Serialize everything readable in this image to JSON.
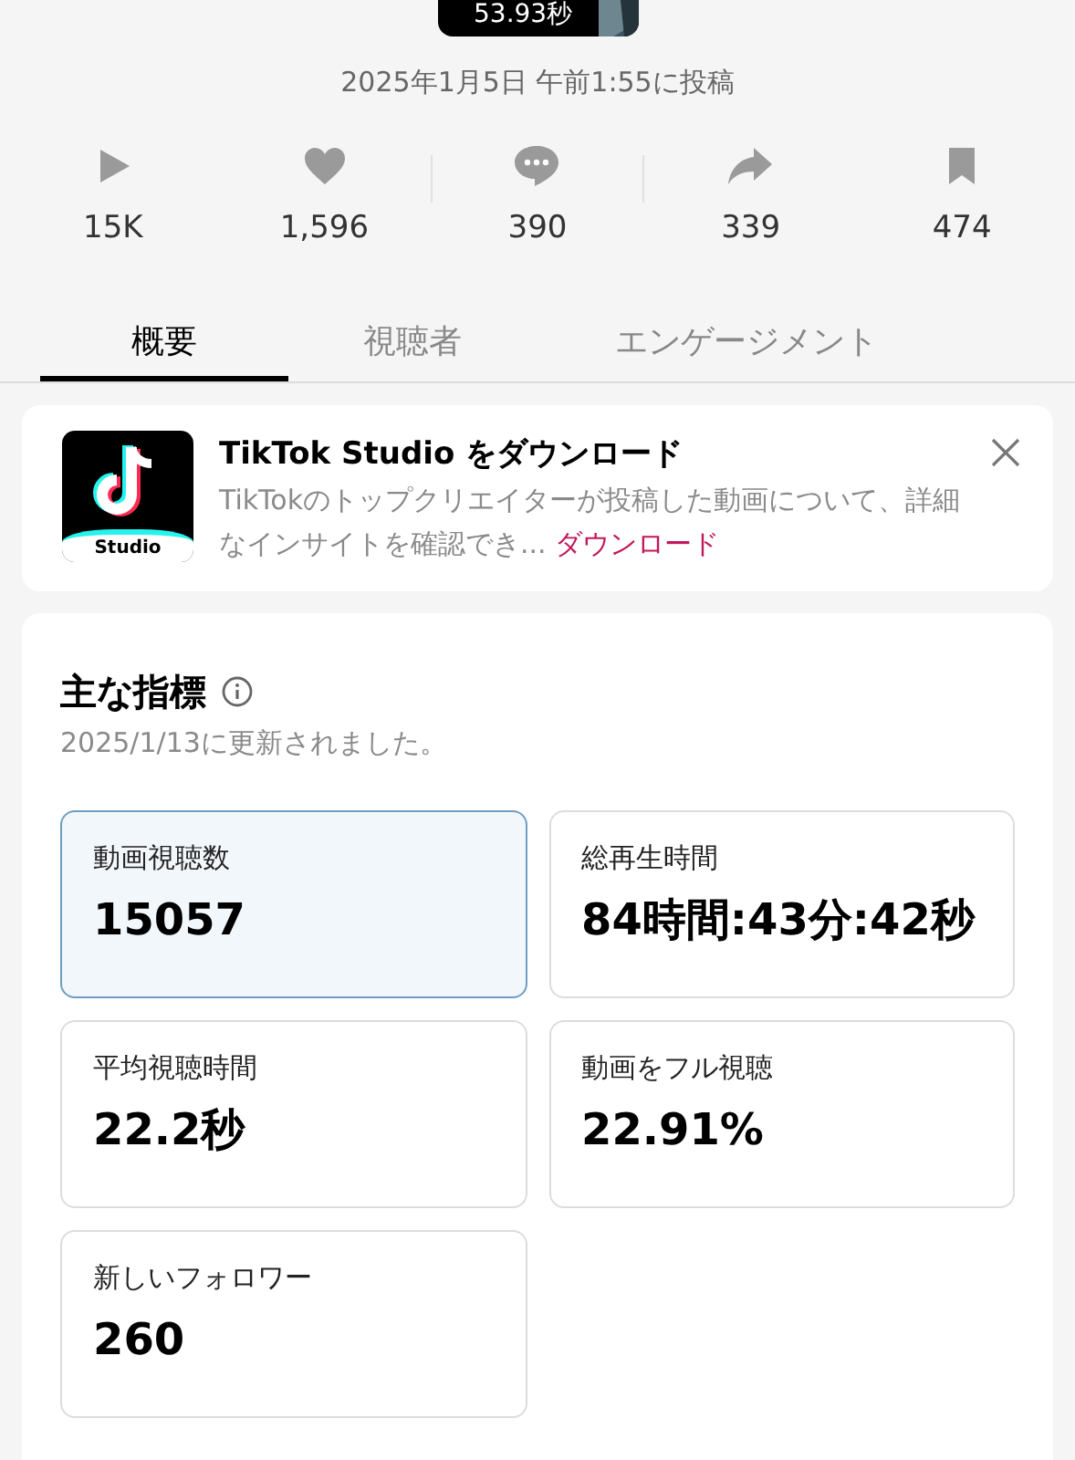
{
  "video": {
    "duration": "53.93秒"
  },
  "posted": "2025年1月5日 午前1:55に投稿",
  "stats": [
    {
      "kind": "play",
      "value": "15K"
    },
    {
      "kind": "like",
      "value": "1,596"
    },
    {
      "kind": "comment",
      "value": "390"
    },
    {
      "kind": "share",
      "value": "339"
    },
    {
      "kind": "save",
      "value": "474"
    }
  ],
  "tabs": [
    {
      "label": "概要",
      "selected": true
    },
    {
      "label": "視聴者",
      "selected": false
    },
    {
      "label": "エンゲージメント",
      "selected": false
    }
  ],
  "banner": {
    "title": "TikTok Studio をダウンロード",
    "app_label": "Studio",
    "text": "TikTokのトップクリエイターが投稿した動画について、詳細なインサイトを確認でき...",
    "link": "ダウンロード"
  },
  "metrics": {
    "title": "主な指標",
    "updated": "2025/1/13に更新されました。",
    "cards": [
      {
        "label": "動画視聴数",
        "value": "15057",
        "selected": true
      },
      {
        "label": "総再生時間",
        "value": "84時間:43分:42秒",
        "selected": false
      },
      {
        "label": "平均視聴時間",
        "value": "22.2秒",
        "selected": false
      },
      {
        "label": "動画をフル視聴",
        "value": "22.91%",
        "selected": false
      },
      {
        "label": "新しいフォロワー",
        "value": "260",
        "selected": false
      }
    ]
  }
}
